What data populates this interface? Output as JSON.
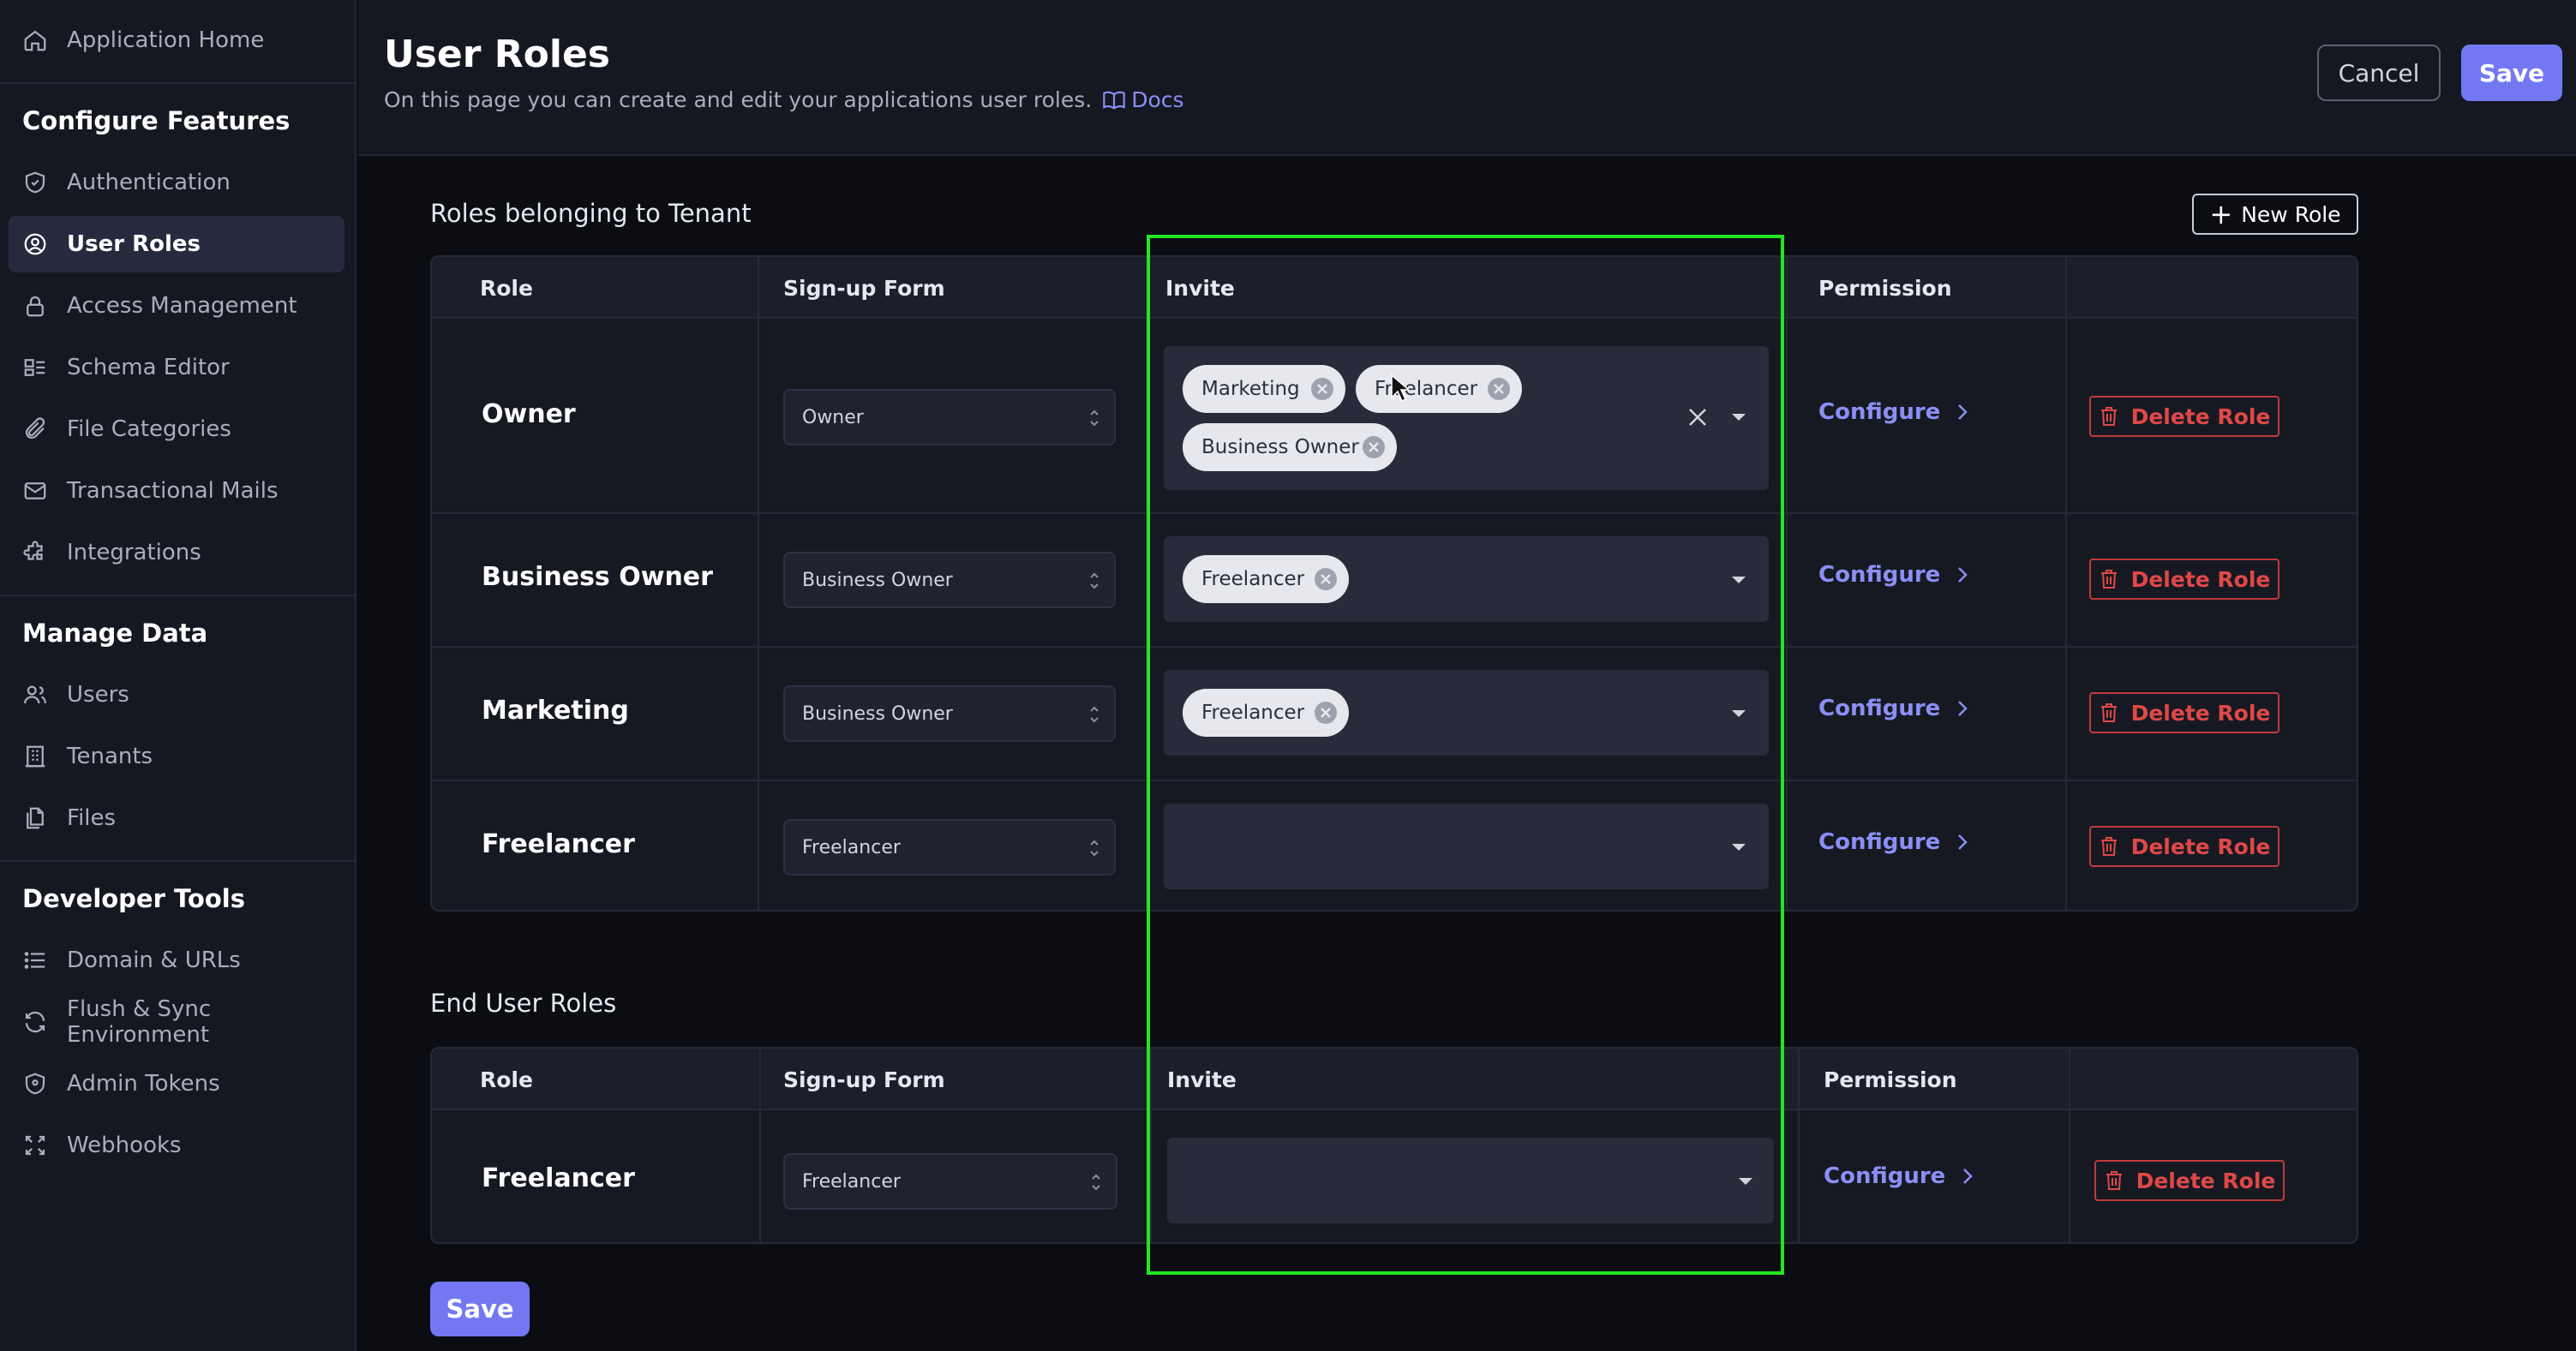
{
  "sidebar": {
    "app_home": "Application Home",
    "sections": {
      "configure": "Configure Features",
      "manage": "Manage Data",
      "developer": "Developer Tools"
    },
    "configure_items": [
      {
        "label": "Authentication",
        "icon": "shield-icon"
      },
      {
        "label": "User Roles",
        "icon": "user-circle-icon",
        "active": true
      },
      {
        "label": "Access Management",
        "icon": "lock-icon"
      },
      {
        "label": "Schema Editor",
        "icon": "schema-icon"
      },
      {
        "label": "File Categories",
        "icon": "paperclip-icon"
      },
      {
        "label": "Transactional Mails",
        "icon": "mail-icon"
      },
      {
        "label": "Integrations",
        "icon": "puzzle-icon"
      }
    ],
    "manage_items": [
      {
        "label": "Users",
        "icon": "users-icon"
      },
      {
        "label": "Tenants",
        "icon": "building-icon"
      },
      {
        "label": "Files",
        "icon": "files-icon"
      }
    ],
    "developer_items": [
      {
        "label": "Domain & URLs",
        "icon": "list-icon"
      },
      {
        "label": "Flush & Sync Environment",
        "icon": "sync-icon"
      },
      {
        "label": "Admin Tokens",
        "icon": "shield-icon"
      },
      {
        "label": "Webhooks",
        "icon": "webhooks-icon"
      }
    ]
  },
  "header": {
    "title": "User Roles",
    "subtitle": "On this page you can create and edit your applications user roles.",
    "docs_label": "Docs",
    "cancel_label": "Cancel",
    "save_label": "Save"
  },
  "tenant_section": {
    "title": "Roles belonging to Tenant",
    "new_role_label": "New Role",
    "columns": [
      "Role",
      "Sign-up Form",
      "Invite",
      "Permission"
    ],
    "rows": [
      {
        "role": "Owner",
        "signup_form": "Owner",
        "invite": [
          "Marketing",
          "Freelancer",
          "Business Owner"
        ]
      },
      {
        "role": "Business Owner",
        "signup_form": "Business Owner",
        "invite": [
          "Freelancer"
        ]
      },
      {
        "role": "Marketing",
        "signup_form": "Business Owner",
        "invite": [
          "Freelancer"
        ]
      },
      {
        "role": "Freelancer",
        "signup_form": "Freelancer",
        "invite": []
      }
    ]
  },
  "end_user_section": {
    "title": "End User Roles",
    "columns": [
      "Role",
      "Sign-up Form",
      "Invite",
      "Permission"
    ],
    "rows": [
      {
        "role": "Freelancer",
        "signup_form": "Freelancer",
        "invite": []
      }
    ]
  },
  "actions": {
    "configure_label": "Configure",
    "delete_label": "Delete Role",
    "save_label": "Save"
  },
  "colors": {
    "accent": "#7378f2",
    "link": "#8b8ff5",
    "danger": "#e04848",
    "highlight": "#22e622"
  }
}
